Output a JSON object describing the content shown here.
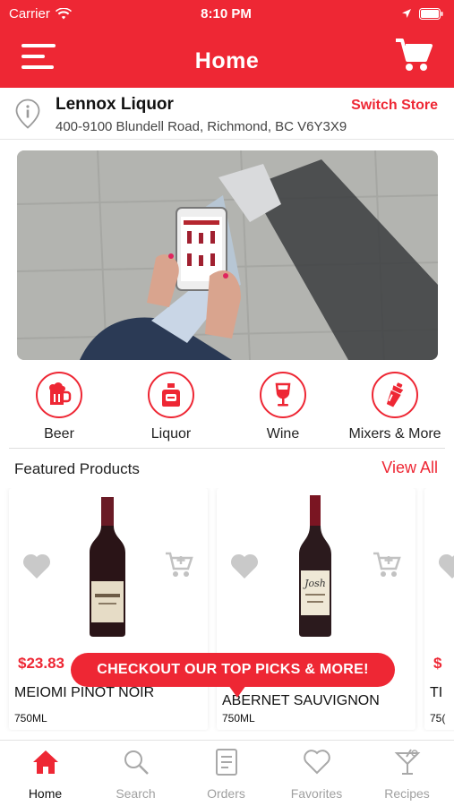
{
  "status_bar": {
    "carrier": "Carrier",
    "time": "8:10 PM"
  },
  "header": {
    "title": "Home"
  },
  "store": {
    "name": "Lennox Liquor",
    "address": "400-9100 Blundell Road, Richmond, BC V6Y3X9",
    "switch_label": "Switch Store"
  },
  "categories": [
    {
      "label": "Beer",
      "icon": "beer-mug-icon"
    },
    {
      "label": "Liquor",
      "icon": "liquor-bottle-icon"
    },
    {
      "label": "Wine",
      "icon": "wine-glass-icon"
    },
    {
      "label": "Mixers & More",
      "icon": "cocktail-shaker-icon"
    }
  ],
  "featured": {
    "title": "Featured Products",
    "view_all": "View All",
    "products": [
      {
        "price": "$23.83",
        "name": "MEIOMI PINOT NOIR",
        "size": "750ML"
      },
      {
        "price": "",
        "name": "ABERNET SAUVIGNON",
        "size": "750ML"
      },
      {
        "price": "$",
        "name": "TI",
        "size": "75("
      }
    ]
  },
  "tooltip": {
    "text": "CHECKOUT OUR TOP PICKS & MORE!"
  },
  "tabs": [
    {
      "label": "Home",
      "icon": "home-icon",
      "active": true
    },
    {
      "label": "Search",
      "icon": "search-icon",
      "active": false
    },
    {
      "label": "Orders",
      "icon": "orders-icon",
      "active": false
    },
    {
      "label": "Favorites",
      "icon": "heart-icon",
      "active": false
    },
    {
      "label": "Recipes",
      "icon": "cocktail-glass-icon",
      "active": false
    }
  ],
  "colors": {
    "accent": "#ee2734",
    "inactive": "#a0a0a0"
  }
}
